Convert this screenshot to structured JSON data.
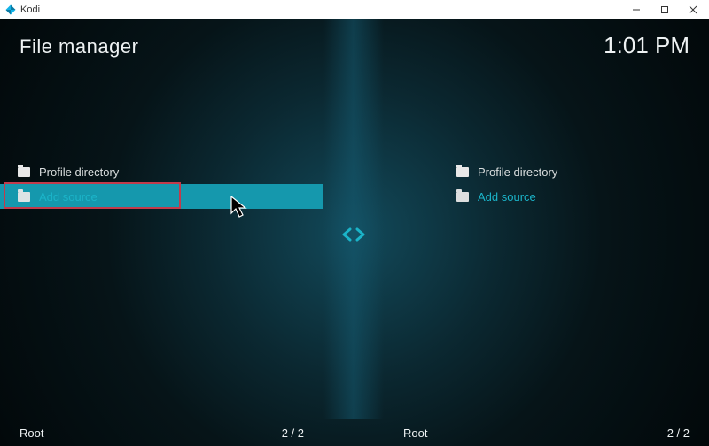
{
  "window": {
    "title": "Kodi"
  },
  "header": {
    "title": "File manager",
    "clock": "1:01 PM"
  },
  "panes": {
    "left": {
      "items": [
        {
          "label": "Profile directory"
        },
        {
          "label": "Add source"
        }
      ]
    },
    "right": {
      "items": [
        {
          "label": "Profile directory"
        },
        {
          "label": "Add source"
        }
      ]
    }
  },
  "footer": {
    "left": {
      "path": "Root",
      "position": "2 / 2"
    },
    "right": {
      "path": "Root",
      "position": "2 / 2"
    }
  }
}
